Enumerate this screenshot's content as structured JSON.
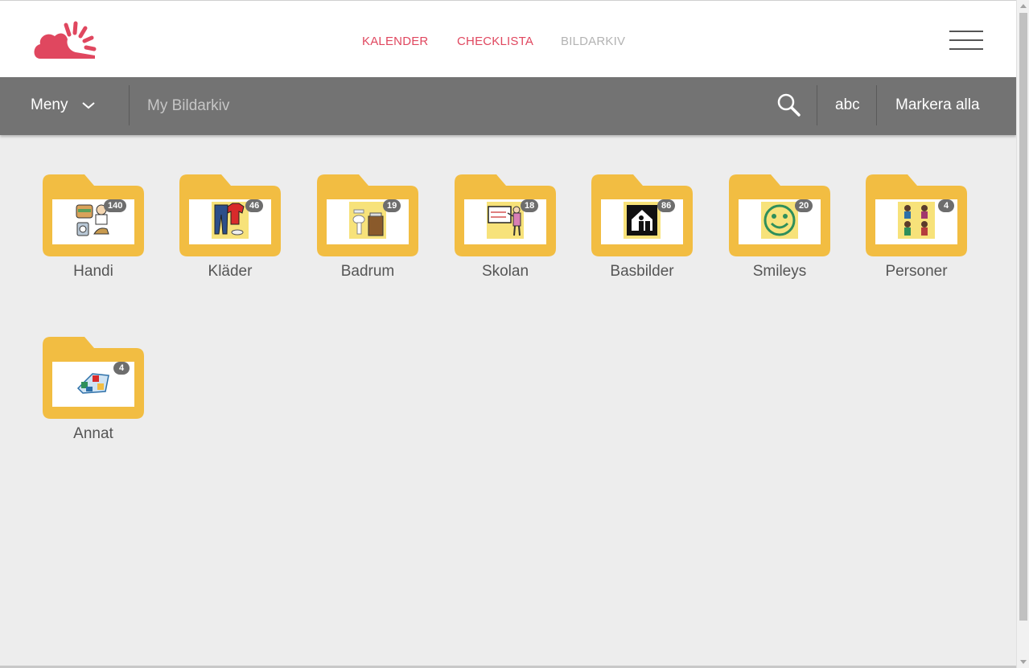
{
  "header": {
    "logo_icon": "cloud-sun-logo",
    "nav": [
      {
        "label": "KALENDER",
        "color": "#e0475f"
      },
      {
        "label": "CHECKLISTA",
        "color": "#e0475f"
      },
      {
        "label": "BILDARKIV",
        "color": "#b3b3b3"
      }
    ],
    "menu_icon": "hamburger-icon"
  },
  "toolbar": {
    "menu_label": "Meny",
    "search_placeholder": "My Bildarkiv",
    "search_value": "",
    "abc_label": "abc",
    "select_all_label": "Markera alla"
  },
  "folders": [
    {
      "name": "Handi",
      "count": "140",
      "icon": "handi-pictogram"
    },
    {
      "name": "Kläder",
      "count": "46",
      "icon": "clothes-pictogram"
    },
    {
      "name": "Badrum",
      "count": "19",
      "icon": "bathroom-pictogram"
    },
    {
      "name": "Skolan",
      "count": "18",
      "icon": "school-pictogram"
    },
    {
      "name": "Basbilder",
      "count": "86",
      "icon": "basic-pictogram"
    },
    {
      "name": "Smileys",
      "count": "20",
      "icon": "smiley-pictogram"
    },
    {
      "name": "Personer",
      "count": "4",
      "icon": "persons-pictogram"
    },
    {
      "name": "Annat",
      "count": "4",
      "icon": "board-game-pictogram"
    }
  ],
  "colors": {
    "brand": "#e0475f",
    "folder": "#f2bd42",
    "toolbar": "#737373",
    "badge": "#6d6d6d",
    "background": "#ededed"
  }
}
